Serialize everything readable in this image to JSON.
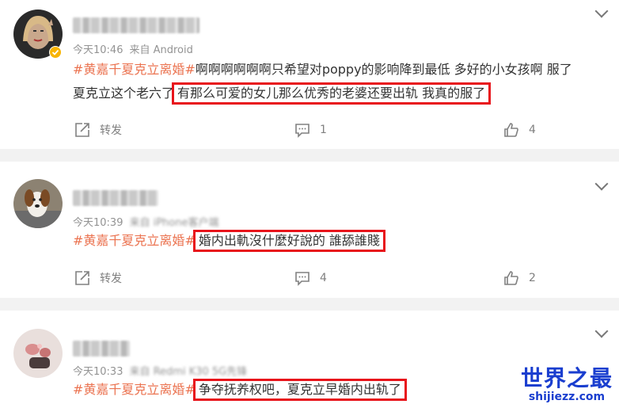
{
  "comments": [
    {
      "username": "",
      "time": "今天10:46",
      "source": "来自 Android",
      "tag": "#黄嘉千夏克立离婚#",
      "text_line1_rest": "啊啊啊啊啊啊只希望对poppy的影响降到最低 多好的小女孩啊 服了",
      "text_line2_prefix": "夏克立这个老六了",
      "highlight": "有那么可爱的女儿那么优秀的老婆还要出轨 我真的服了",
      "repost_label": "转发",
      "comment_count": "1",
      "like_count": "4",
      "verified_badge": "verified-badge-icon"
    },
    {
      "username": "",
      "time": "今天10:39",
      "source": "来自 iPhone客户端",
      "tag": "#黄嘉千夏克立离婚#",
      "highlight": "婚内出軌沒什麼好說的 誰舔誰賤",
      "repost_label": "转发",
      "comment_count": "4",
      "like_count": "2"
    },
    {
      "username": "",
      "time": "今天10:33",
      "source": "来自 Redmi K30 5G先锋",
      "tag": "#黄嘉千夏克立离婚#",
      "highlight": "争夺抚养权吧，夏克立早婚内出轨了"
    }
  ],
  "watermark": {
    "title": "世界之最",
    "url": "shijiezz.com"
  },
  "colors": {
    "tag": "#eb7350",
    "highlight_border": "#e8141b",
    "watermark": "#1a3ecf"
  }
}
